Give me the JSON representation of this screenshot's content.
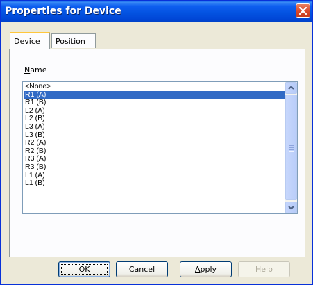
{
  "window": {
    "title": "Properties for Device"
  },
  "tabs": [
    {
      "label": "Device",
      "active": true
    },
    {
      "label": "Position",
      "active": false
    }
  ],
  "name_field": {
    "label_accel": "N",
    "label_rest": "ame",
    "items": [
      "<None>",
      "R1 (A)",
      "R1 (B)",
      "L2 (A)",
      "L2 (B)",
      "L3 (A)",
      "L3 (B)",
      "R2 (A)",
      "R2 (B)",
      "R3 (A)",
      "R3 (B)",
      "L1 (A)",
      "L1 (B)"
    ],
    "selected": "R1 (A)"
  },
  "buttons": {
    "ok": "OK",
    "cancel": "Cancel",
    "apply_accel": "A",
    "apply_rest": "pply",
    "help": "Help"
  },
  "colors": {
    "titlebar": "#0052e0",
    "selection": "#316ac5",
    "tab_highlight": "#ffc73c"
  },
  "icons": {
    "close": "close-icon",
    "scroll_up": "chevron-up-icon",
    "scroll_down": "chevron-down-icon"
  }
}
